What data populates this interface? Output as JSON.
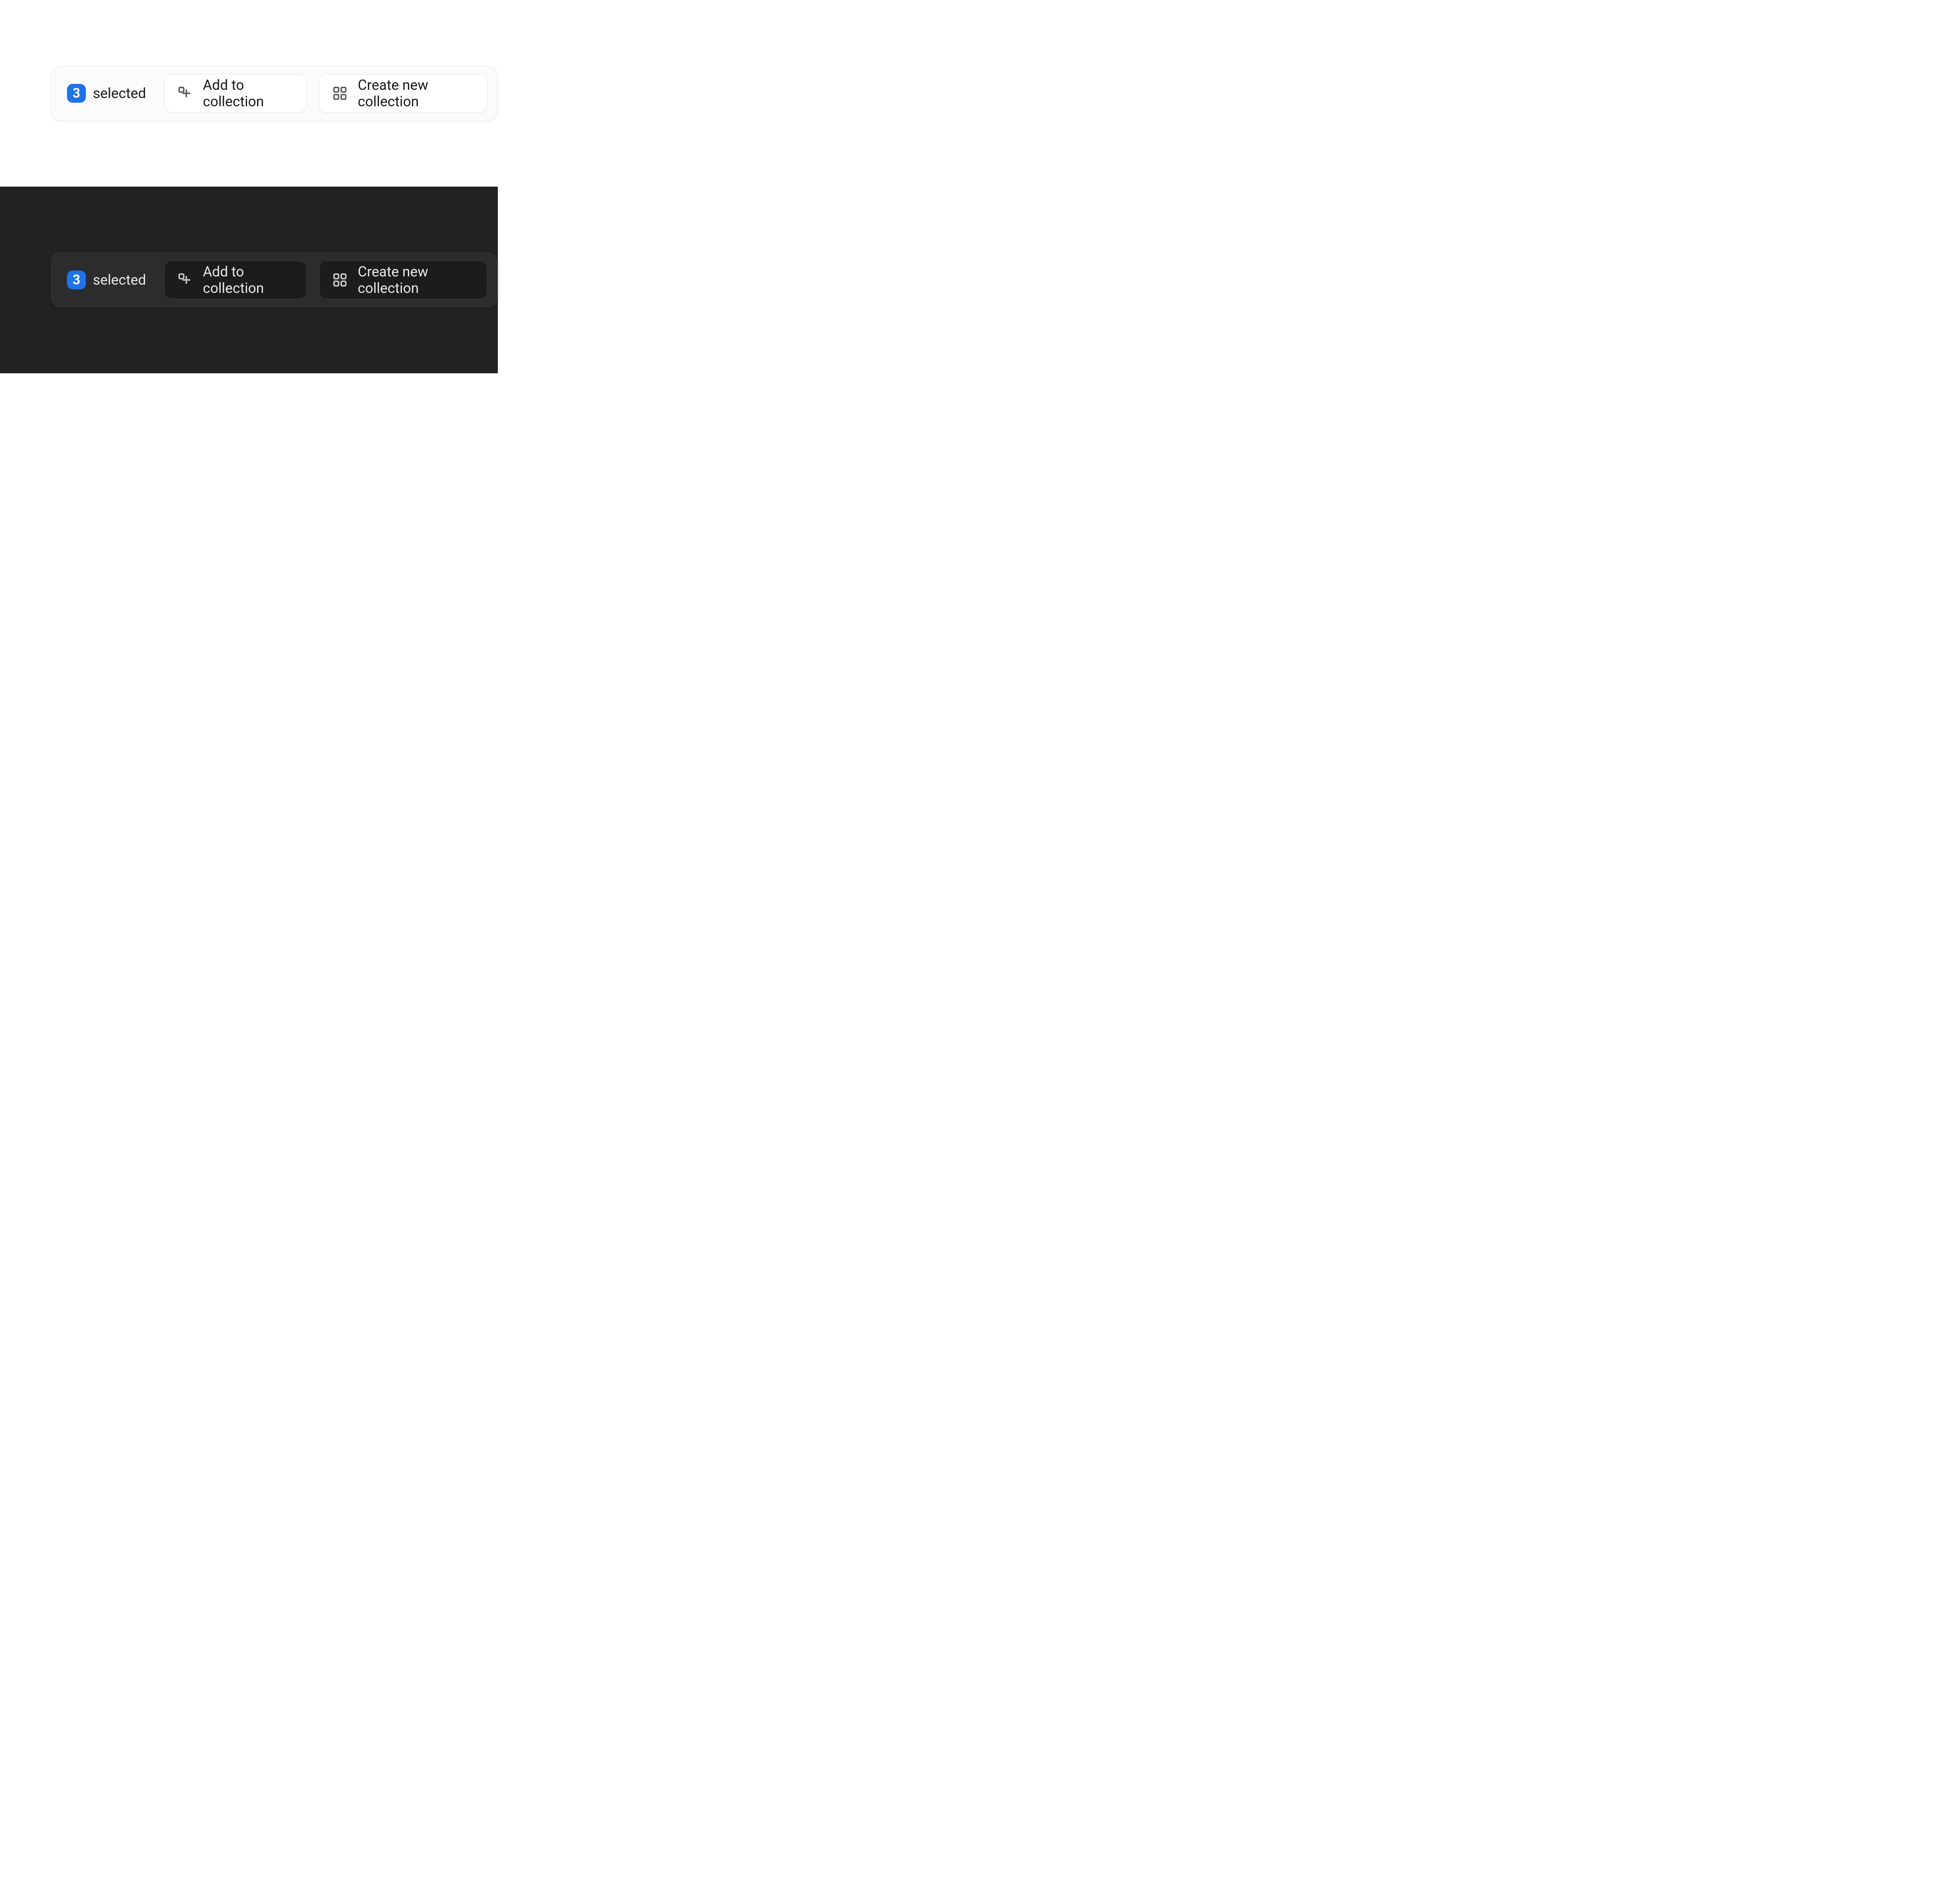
{
  "selection": {
    "count": "3",
    "label": "selected"
  },
  "actions": {
    "add_to_collection": "Add to collection",
    "create_new_collection": "Create new collection"
  },
  "colors": {
    "badge_bg": "#1e73e8",
    "light_bg": "#ffffff",
    "dark_bg": "#212224"
  }
}
